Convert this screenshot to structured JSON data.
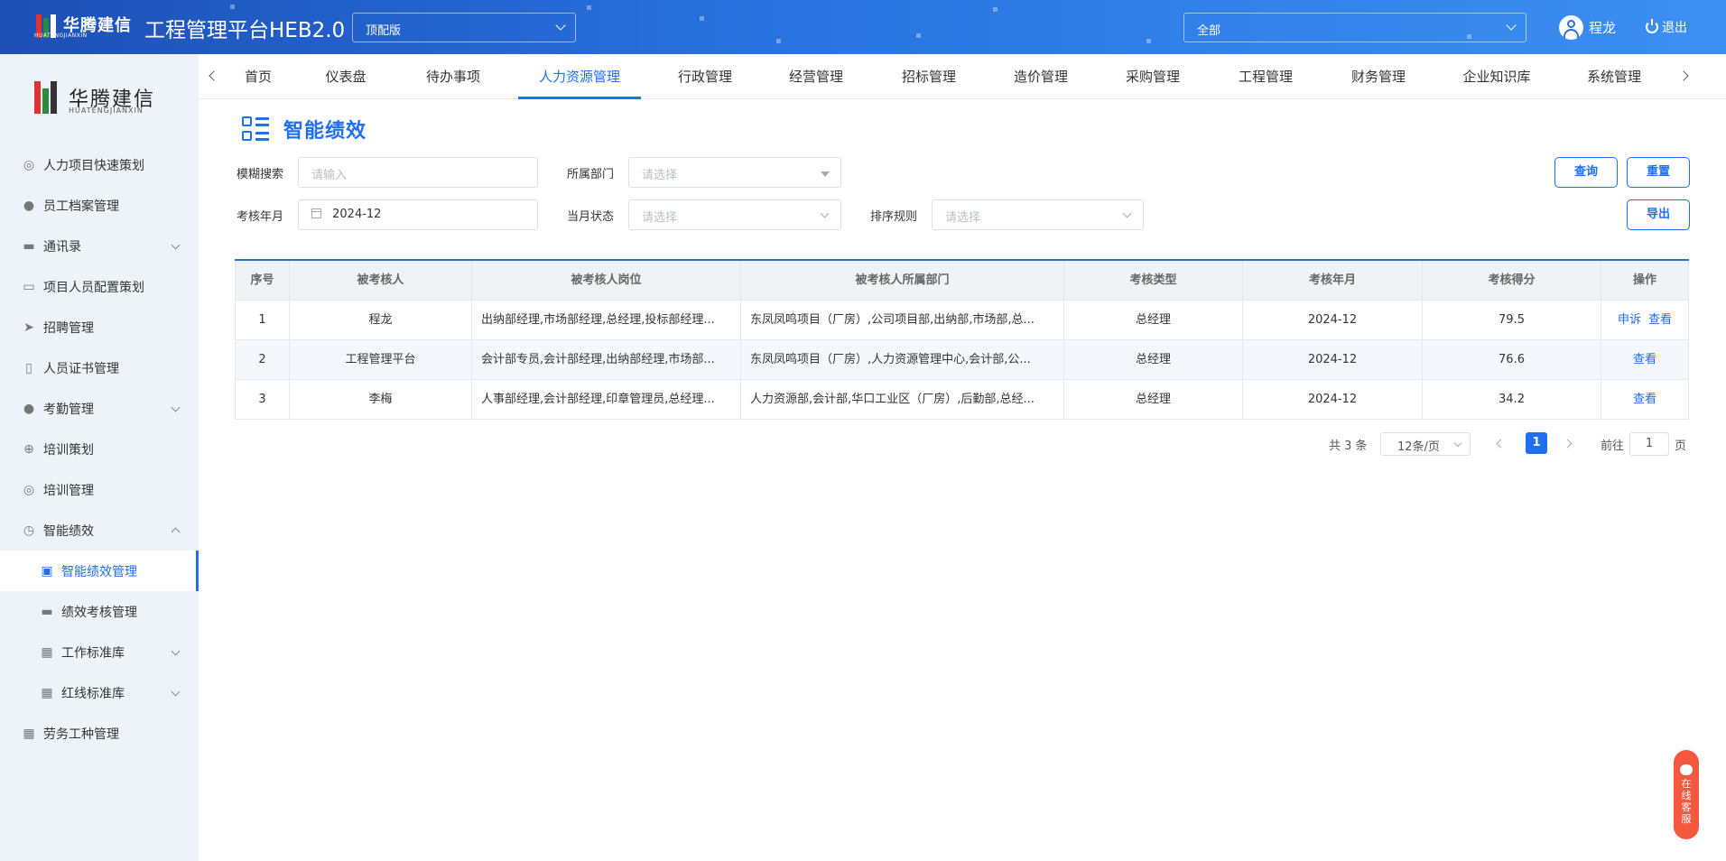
{
  "header": {
    "logo_text": "华腾建信",
    "logo_sub": "HUATENGJIANXIN",
    "app_title": "工程管理平台HEB2.0",
    "edition": "顶配版",
    "scope": "全部",
    "user_name": "程龙",
    "logout": "退出"
  },
  "sidebar": {
    "brand": "华腾建信",
    "brand_sub": "HUATENGJIANXIN",
    "items": [
      {
        "label": "人力项目快速策划"
      },
      {
        "label": "员工档案管理"
      },
      {
        "label": "通讯录"
      },
      {
        "label": "项目人员配置策划"
      },
      {
        "label": "招聘管理"
      },
      {
        "label": "人员证书管理"
      },
      {
        "label": "考勤管理"
      },
      {
        "label": "培训策划"
      },
      {
        "label": "培训管理"
      },
      {
        "label": "智能绩效"
      },
      {
        "label": "智能绩效管理"
      },
      {
        "label": "绩效考核管理"
      },
      {
        "label": "工作标准库"
      },
      {
        "label": "红线标准库"
      },
      {
        "label": "劳务工种管理"
      }
    ]
  },
  "tabs": [
    {
      "label": "首页"
    },
    {
      "label": "仪表盘"
    },
    {
      "label": "待办事项"
    },
    {
      "label": "人力资源管理"
    },
    {
      "label": "行政管理"
    },
    {
      "label": "经营管理"
    },
    {
      "label": "招标管理"
    },
    {
      "label": "造价管理"
    },
    {
      "label": "采购管理"
    },
    {
      "label": "工程管理"
    },
    {
      "label": "财务管理"
    },
    {
      "label": "企业知识库"
    },
    {
      "label": "系统管理"
    }
  ],
  "page": {
    "title": "智能绩效"
  },
  "filters": {
    "search_label": "模糊搜索",
    "search_placeholder": "请输入",
    "dept_label": "所属部门",
    "dept_placeholder": "请选择",
    "month_label": "考核年月",
    "month_value": "2024-12",
    "status_label": "当月状态",
    "status_placeholder": "请选择",
    "sort_label": "排序规则",
    "sort_placeholder": "请选择",
    "query_button": "查询",
    "reset_button": "重置",
    "export_button": "导出"
  },
  "table": {
    "headers": [
      "序号",
      "被考核人",
      "被考核人岗位",
      "被考核人所属部门",
      "考核类型",
      "考核年月",
      "考核得分",
      "操作"
    ],
    "rows": [
      {
        "no": "1",
        "name": "程龙",
        "post": "出纳部经理,市场部经理,总经理,投标部经理...",
        "dept": "东凤凤鸣项目（厂房）,公司项目部,出纳部,市场部,总...",
        "type": "总经理",
        "month": "2024-12",
        "score": "79.5",
        "action1": "申诉",
        "action2": "查看"
      },
      {
        "no": "2",
        "name": "工程管理平台",
        "post": "会计部专员,会计部经理,出纳部经理,市场部...",
        "dept": "东凤凤鸣项目（厂房）,人力资源管理中心,会计部,公...",
        "type": "总经理",
        "month": "2024-12",
        "score": "76.6",
        "action1": "查看"
      },
      {
        "no": "3",
        "name": "李梅",
        "post": "人事部经理,会计部经理,印章管理员,总经理...",
        "dept": "人力资源部,会计部,华口工业区（厂房）,后勤部,总经...",
        "type": "总经理",
        "month": "2024-12",
        "score": "34.2",
        "action1": "查看"
      }
    ]
  },
  "pagination": {
    "total_text": "共 3 条",
    "page_size": "12条/页",
    "current_page": "1",
    "goto_prefix": "前往",
    "goto_value": "1",
    "goto_suffix": "页"
  },
  "service": {
    "label_1": "在",
    "label_2": "线",
    "label_3": "客",
    "label_4": "服"
  },
  "colors": {
    "primary": "#1f6ff0",
    "header_start": "#1d4fb6",
    "header_end": "#3d8ff2",
    "sidebar_bg": "#eef3f9",
    "service": "#f4583f"
  }
}
